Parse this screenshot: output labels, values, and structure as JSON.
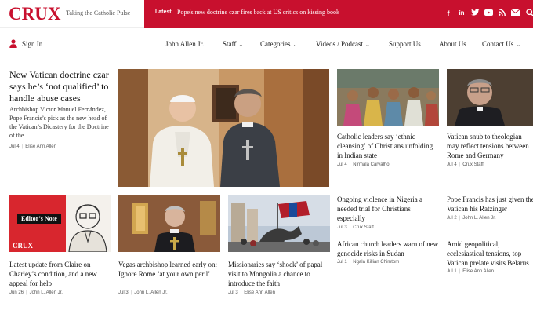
{
  "header": {
    "logo": "CRUX",
    "tagline": "Taking the Catholic Pulse",
    "latest_label": "Latest",
    "latest_headline": "Pope's new doctrine czar fires back at US critics on kissing book",
    "social_icons": [
      "facebook-icon",
      "linkedin-icon",
      "twitter-icon",
      "youtube-icon",
      "rss-icon",
      "mail-icon",
      "search-icon"
    ]
  },
  "nav": {
    "signin": "Sign In",
    "items": [
      {
        "label": "John Allen Jr.",
        "dropdown": false
      },
      {
        "label": "Staff",
        "dropdown": true
      },
      {
        "label": "Categories",
        "dropdown": true
      },
      {
        "label": "Videos / Podcast",
        "dropdown": true
      },
      {
        "label": "Support Us",
        "dropdown": false
      },
      {
        "label": "About Us",
        "dropdown": false
      },
      {
        "label": "Contact Us",
        "dropdown": true
      }
    ]
  },
  "lead": {
    "title": "New Vatican doctrine czar says he’s ‘not qualified’ to handle abuse cases",
    "excerpt": "Archbishop Victor Manuel Fernández, Pope Francis’s pick as the new head of the Vatican’s Dicastery for the Doctrine of the…",
    "date": "Jul 4",
    "author": "Elise Ann Allen"
  },
  "top_cards": [
    {
      "title": "Catholic leaders say ‘ethnic cleansing’ of Christians unfolding in Indian state",
      "date": "Jul 4",
      "author": "Nirmala Carvalho"
    },
    {
      "title": "Vatican snub to theologian may reflect tensions between Rome and Germany",
      "date": "Jul 4",
      "author": "Crux Staff"
    }
  ],
  "bottom_cards": [
    {
      "title": "Latest update from Claire on Charley’s condition, and a new appeal for help",
      "date": "Jun 26",
      "author": "John L. Allen Jr.",
      "badge": "Editor’s Note",
      "badge_logo": "CRUX"
    },
    {
      "title": "Vegas archbishop learned early on: Ignore Rome ‘at your own peril’",
      "date": "Jul 3",
      "author": "John L. Allen Jr."
    },
    {
      "title": "Missionaries say ‘shock’ of papal visit to Mongolia a chance to introduce the faith",
      "date": "Jul 3",
      "author": "Elise Ann Allen"
    }
  ],
  "right_list": [
    {
      "title": "Ongoing violence in Nigeria a needed trial for Christians especially",
      "date": "Jul 3",
      "author": "Crux Staff"
    },
    {
      "title": "Pope Francis has just given the Vatican his Ratzinger",
      "date": "Jul 2",
      "author": "John L. Allen Jr."
    },
    {
      "title": "African church leaders warn of new genocide risks in Sudan",
      "date": "Jul 1",
      "author": "Ngala Killian Chimtom"
    },
    {
      "title": "Amid geopolitical, ecclesiastical tensions, top Vatican prelate visits Belarus",
      "date": "Jul 1",
      "author": "Elise Ann Allen"
    }
  ],
  "colors": {
    "brand": "#c8102e",
    "text": "#111111",
    "meta": "#555555"
  }
}
